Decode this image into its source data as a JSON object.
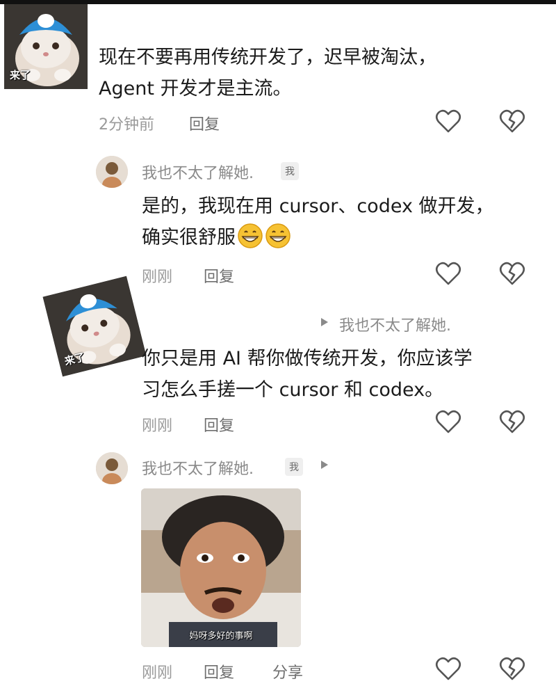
{
  "comments": [
    {
      "sticker_tag": "来了",
      "text_lines": [
        "现在不要再用传统开发了，迟早被淘汰，",
        "Agent 开发才是主流。"
      ],
      "time": "2分钟前",
      "reply": "回复"
    },
    {
      "username": "我也不太了解她.",
      "badge": "我",
      "text_lines": [
        "是的，我现在用 cursor、codex 做开发，",
        "确实很舒服"
      ],
      "time": "刚刚",
      "reply": "回复"
    },
    {
      "sticker_tag": "来了",
      "reply_to": "我也不太了解她.",
      "text_lines": [
        "你只是用 AI 帮你做传统开发，你应该学",
        "习怎么手搓一个 cursor 和 codex。"
      ],
      "time": "刚刚",
      "reply": "回复"
    },
    {
      "username": "我也不太了解她.",
      "badge": "我",
      "video_caption": "妈呀多好的事啊",
      "time": "刚刚",
      "reply": "回复",
      "share": "分享"
    }
  ],
  "icons": {
    "like": "heart-outline-icon",
    "dislike": "broken-heart-icon",
    "reply_arrow": "play-triangle-icon",
    "emoji": "grinning-face-icon"
  },
  "colors": {
    "text": "#1b1b1b",
    "meta": "#9a9a9a",
    "icon": "#555555",
    "background": "#ffffff"
  }
}
